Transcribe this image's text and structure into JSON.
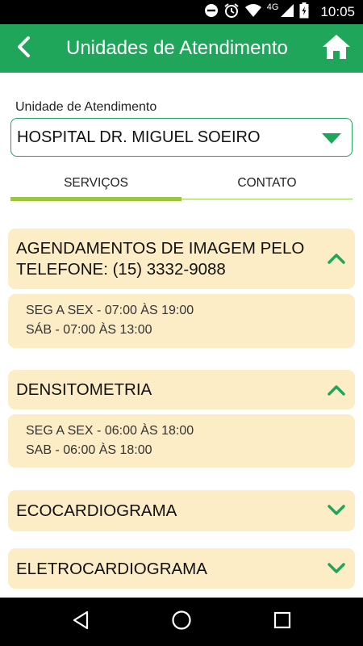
{
  "status_bar": {
    "network": "4G",
    "time": "10:05"
  },
  "app_bar": {
    "title": "Unidades de Atendimento"
  },
  "unit_select": {
    "label": "Unidade de Atendimento",
    "value": "HOSPITAL DR. MIGUEL SOEIRO"
  },
  "tabs": [
    {
      "label": "SERVIÇOS",
      "selected": true
    },
    {
      "label": "CONTATO",
      "selected": false
    }
  ],
  "services": [
    {
      "title_lines": [
        "AGENDAMENTOS DE IMAGEM PELO",
        "TELEFONE: (15) 3332-9088"
      ],
      "expanded": true,
      "hours": [
        "SEG A SEX - 07:00 ÀS 19:00",
        "SÁB - 07:00 ÀS 13:00"
      ]
    },
    {
      "title_lines": [
        "DENSITOMETRIA"
      ],
      "expanded": true,
      "hours": [
        "SEG A SEX - 06:00 ÀS 18:00",
        "SAB - 06:00 ÀS 18:00"
      ]
    },
    {
      "title_lines": [
        "ECOCARDIOGRAMA"
      ],
      "expanded": false
    },
    {
      "title_lines": [
        "ELETROCARDIOGRAMA"
      ],
      "expanded": false
    }
  ],
  "colors": {
    "primary": "#1fa65a",
    "accent": "#9cc63c",
    "card": "#fcedc6"
  },
  "icons": {
    "back": "arrow-back-icon",
    "home": "home-icon",
    "dropdown": "triangle-down-icon",
    "expand": "chevron-down-icon",
    "collapse": "chevron-up-icon"
  }
}
